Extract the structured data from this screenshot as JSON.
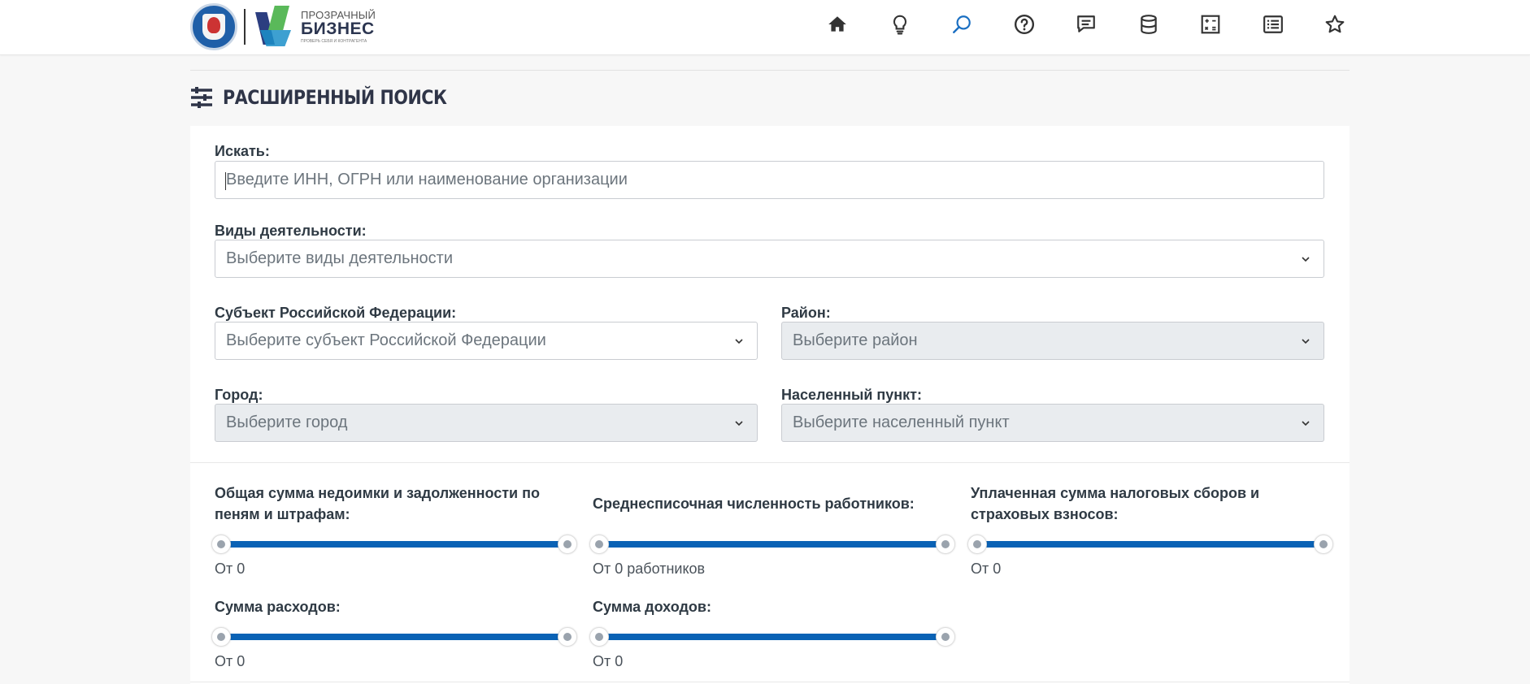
{
  "header": {
    "brand_top": "ПРОЗРАЧНЫЙ",
    "brand_main": "БИЗНЕС",
    "brand_sub": "ПРОВЕРЬ СЕБЯ И КОНТРАГЕНТА",
    "nav": [
      {
        "name": "home-icon"
      },
      {
        "name": "lightbulb-icon"
      },
      {
        "name": "search-icon",
        "active": true
      },
      {
        "name": "help-icon"
      },
      {
        "name": "chat-icon"
      },
      {
        "name": "database-icon"
      },
      {
        "name": "calculator-icon"
      },
      {
        "name": "list-icon"
      },
      {
        "name": "star-icon"
      }
    ],
    "nav_color": "#333333",
    "nav_active_color": "#1a6fc2"
  },
  "page": {
    "title": "РАСШИРЕННЫЙ ПОИСК"
  },
  "form": {
    "search": {
      "label": "Искать:",
      "value": "",
      "placeholder": "Введите ИНН, ОГРН или наименование организации"
    },
    "activity": {
      "label": "Виды деятельности:",
      "value": "Выберите виды деятельности"
    },
    "region": {
      "label": "Субъект Российской Федерации:",
      "value": "Выберите субъект Российской Федерации"
    },
    "district": {
      "label": "Район:",
      "value": "Выберите район"
    },
    "city": {
      "label": "Город:",
      "value": "Выберите город"
    },
    "locality": {
      "label": "Населенный пункт:",
      "value": "Выберите населенный пункт"
    }
  },
  "ranges": {
    "arrears": {
      "label_line1": "Общая сумма недоимки и задолженности по",
      "label_line2": "пеням и штрафам:",
      "value_text": "От 0",
      "min_fraction": 0,
      "max_fraction": 1
    },
    "employees": {
      "label": "Среднесписочная численность работников:",
      "value_text": "От 0 работников",
      "min_fraction": 0,
      "max_fraction": 1
    },
    "taxes_paid": {
      "label_line1": "Уплаченная сумма налоговых сборов и",
      "label_line2": "страховых взносов:",
      "value_text": "От 0",
      "min_fraction": 0,
      "max_fraction": 1
    },
    "expenses": {
      "label": "Сумма расходов:",
      "value_text": "От 0",
      "min_fraction": 0,
      "max_fraction": 1
    },
    "income": {
      "label": "Сумма доходов:",
      "value_text": "От 0",
      "min_fraction": 0,
      "max_fraction": 1
    }
  },
  "colors": {
    "slider_track": "#0a62b5",
    "heading": "#2f3548"
  }
}
